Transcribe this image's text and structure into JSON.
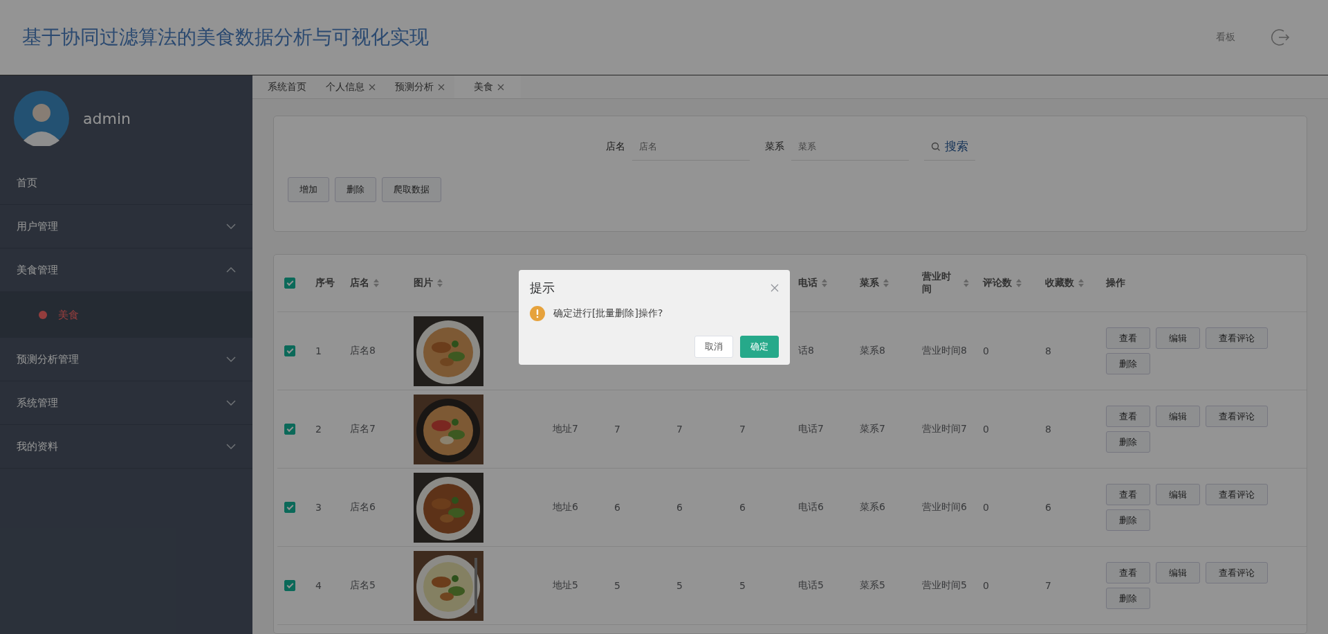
{
  "header": {
    "title": "基于协同过滤算法的美食数据分析与可视化实现",
    "links": [
      {
        "label": "看板"
      }
    ]
  },
  "sidebar": {
    "user": {
      "name": "admin"
    },
    "menu": [
      {
        "label": "首页",
        "kind": "link"
      },
      {
        "label": "用户管理",
        "kind": "group",
        "expanded": false
      },
      {
        "label": "美食管理",
        "kind": "group",
        "expanded": true,
        "children": [
          {
            "label": "美食",
            "selected": true
          }
        ]
      },
      {
        "label": "预测分析管理",
        "kind": "group",
        "expanded": false
      },
      {
        "label": "系统管理",
        "kind": "group",
        "expanded": false
      },
      {
        "label": "我的资料",
        "kind": "group",
        "expanded": false
      }
    ]
  },
  "tabs": [
    {
      "label": "系统首页",
      "closable": false,
      "selected": false
    },
    {
      "label": "个人信息",
      "closable": true,
      "selected": false
    },
    {
      "label": "预测分析",
      "closable": true,
      "selected": false
    },
    {
      "label": "美食",
      "closable": true,
      "selected": true
    }
  ],
  "search": {
    "fields": [
      {
        "label": "店名",
        "placeholder": "店名"
      },
      {
        "label": "菜系",
        "placeholder": "菜系"
      }
    ],
    "button": "搜索"
  },
  "actions": [
    "增加",
    "删除",
    "爬取数据"
  ],
  "table": {
    "select_all": true,
    "columns": {
      "index": {
        "label": "序号"
      },
      "shop_name": {
        "label": "店名",
        "sortable": true
      },
      "picture": {
        "label": "图片",
        "sortable": true
      },
      "phone": {
        "label": "电话",
        "sortable": true
      },
      "cuisine": {
        "label": "菜系",
        "sortable": true
      },
      "hours": {
        "label": "营业时间",
        "sortable": true
      },
      "comment_count": {
        "label": "评论数",
        "sortable": true
      },
      "favorite_count": {
        "label": "收藏数",
        "sortable": true
      },
      "actions": {
        "label": "操作"
      }
    },
    "rows": [
      {
        "checked": true,
        "index": "1",
        "shop_name": "店名8",
        "phone": "话8",
        "cuisine": "菜系8",
        "hours": "营业时间8",
        "comment_count": "0",
        "favorite_count": "8",
        "actions": [
          "查看",
          "编辑",
          "查看评论",
          "删除"
        ]
      },
      {
        "checked": true,
        "index": "2",
        "shop_name": "店名7",
        "address": "地址7",
        "column_6": "7",
        "column_7": "7",
        "column_8": "7",
        "phone": "电话7",
        "cuisine": "菜系7",
        "hours": "营业时间7",
        "comment_count": "0",
        "favorite_count": "8",
        "actions": [
          "查看",
          "编辑",
          "查看评论",
          "删除"
        ]
      },
      {
        "checked": true,
        "index": "3",
        "shop_name": "店名6",
        "address": "地址6",
        "column_6": "6",
        "column_7": "6",
        "column_8": "6",
        "phone": "电话6",
        "cuisine": "菜系6",
        "hours": "营业时间6",
        "comment_count": "0",
        "favorite_count": "6",
        "actions": [
          "查看",
          "编辑",
          "查看评论",
          "删除"
        ]
      },
      {
        "checked": true,
        "index": "4",
        "shop_name": "店名5",
        "address": "地址5",
        "column_6": "5",
        "column_7": "5",
        "column_8": "5",
        "phone": "电话5",
        "cuisine": "菜系5",
        "hours": "营业时间5",
        "comment_count": "0",
        "favorite_count": "7",
        "actions": [
          "查看",
          "编辑",
          "查看评论",
          "删除"
        ]
      }
    ]
  },
  "dialog": {
    "title": "提示",
    "message": "确定进行[批量删除]操作?",
    "buttons": [
      {
        "label": "取消",
        "kind": "default"
      },
      {
        "label": "确定",
        "kind": "primary"
      }
    ]
  }
}
